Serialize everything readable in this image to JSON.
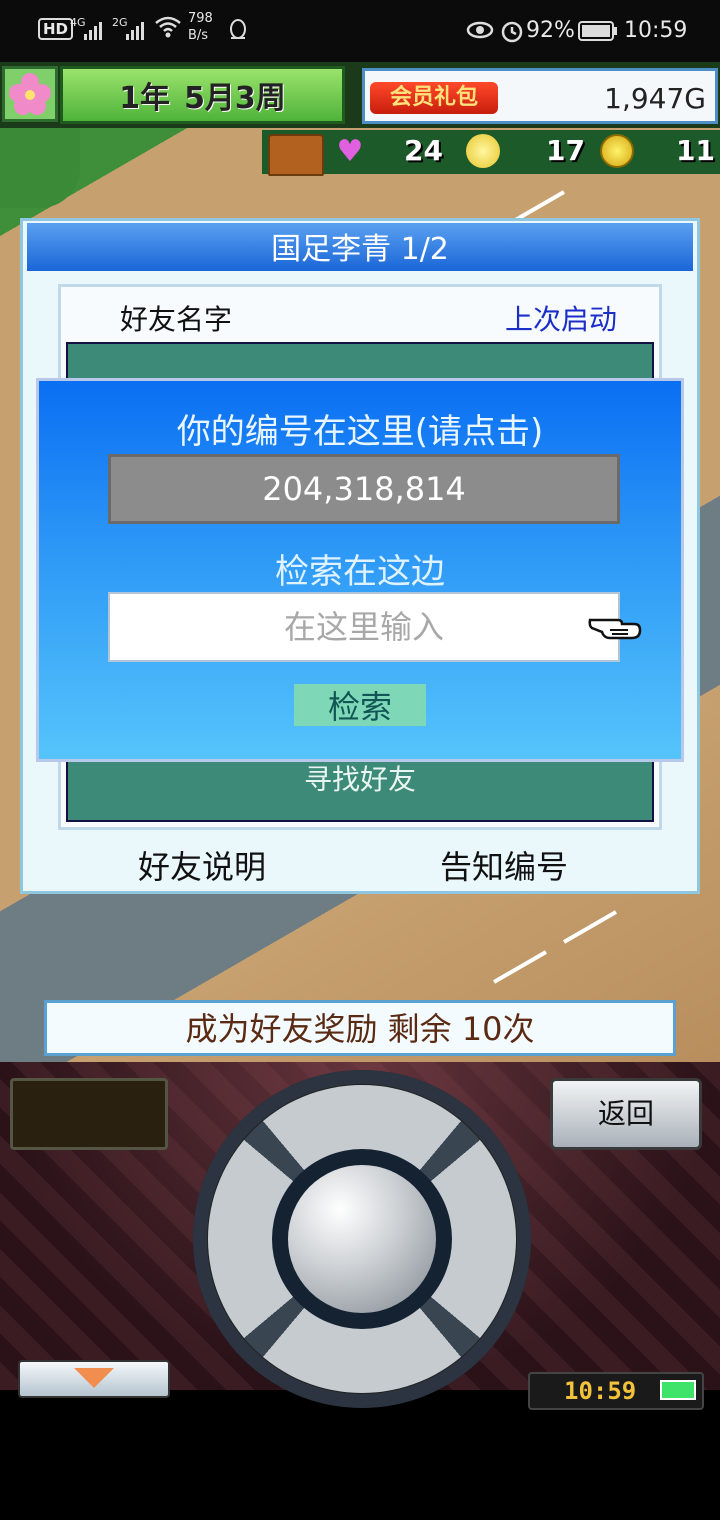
{
  "status_bar": {
    "hd": "HD",
    "signal_a": "4G",
    "signal_b": "2G",
    "speed_value": "798",
    "speed_unit": "B/s",
    "battery": "92%",
    "time": "10:59"
  },
  "hud": {
    "date_year": "1年",
    "date_week": "5月3周",
    "member_gift": "会员礼包",
    "money": "1,947G",
    "hearts": "24",
    "ideas": "17",
    "coins": "11"
  },
  "dialog": {
    "title": "国足李青 1/2",
    "col_friend_name": "好友名字",
    "col_last_launch": "上次启动",
    "find_friend": "寻找好友",
    "friend_explain": "好友说明",
    "tell_id": "告知编号"
  },
  "popup": {
    "title": "你的编号在这里(请点击)",
    "player_id": "204,318,814",
    "search_label": "检索在这边",
    "search_placeholder": "在这里输入",
    "search_button": "检索"
  },
  "reward_bar": "成为好友奖励 剩余 10次",
  "controller": {
    "back_button": "返回",
    "clock": "10:59"
  },
  "colors": {
    "popup_top": "#0a6ff2",
    "popup_bottom": "#56c4fb",
    "list_green": "#3d8a78",
    "search_button_bg": "#7ed8b8",
    "member_red": "#e0301a"
  }
}
